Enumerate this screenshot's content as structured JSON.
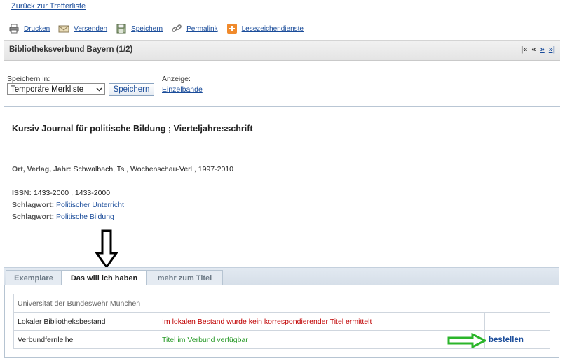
{
  "back_link": "Zurück zur Trefferliste",
  "toolbar": [
    {
      "label": "Drucken",
      "icon": "printer-icon"
    },
    {
      "label": "Versenden",
      "icon": "envelope-icon"
    },
    {
      "label": "Speichern",
      "icon": "floppy-icon"
    },
    {
      "label": "Permalink",
      "icon": "chain-link-icon"
    },
    {
      "label": "Lesezeichendienste",
      "icon": "plus-icon"
    }
  ],
  "header": {
    "title": "Bibliotheksverbund Bayern (1/2)",
    "pager": {
      "first": "|«",
      "prev": "«",
      "next": "»",
      "last": "»|"
    }
  },
  "save": {
    "label": "Speichern in:",
    "selected_option": "Temporäre Merkliste",
    "button_label": "Speichern"
  },
  "display": {
    "label": "Anzeige:",
    "link": "Einzelbände"
  },
  "record": {
    "title": "Kursiv Journal für politische Bildung ; Vierteljahresschrift",
    "fields": [
      {
        "label": "Ort, Verlag, Jahr:",
        "value": "Schwalbach, Ts., Wochenschau-Verl., 1997-2010",
        "link": false
      },
      {
        "label": "ISSN:",
        "value": "1433-2000 , 1433-2000",
        "link": false
      },
      {
        "label": "Schlagwort:",
        "value": "Politischer Unterricht",
        "link": true
      },
      {
        "label": "Schlagwort:",
        "value": "Politische Bildung",
        "link": true
      }
    ]
  },
  "tabs": [
    {
      "label": "Exemplare",
      "active": false
    },
    {
      "label": "Das will ich haben",
      "active": true
    },
    {
      "label": "mehr zum Titel",
      "active": false
    }
  ],
  "holdings": {
    "institution": "Universität der Bundeswehr München",
    "rows": [
      {
        "label": "Lokaler Bibliotheksbestand",
        "status": "Im lokalen Bestand wurde kein korrespondierender Titel ermittelt",
        "status_color": "#c00000",
        "action": ""
      },
      {
        "label": "Verbundfernleihe",
        "status": "Titel im Verbund verfügbar",
        "status_color": "#2a9b2a",
        "action": "bestellen"
      }
    ]
  },
  "colors": {
    "link": "#1a4c9a",
    "annotation_green": "#2bb52b",
    "annotation_black": "#000000"
  }
}
